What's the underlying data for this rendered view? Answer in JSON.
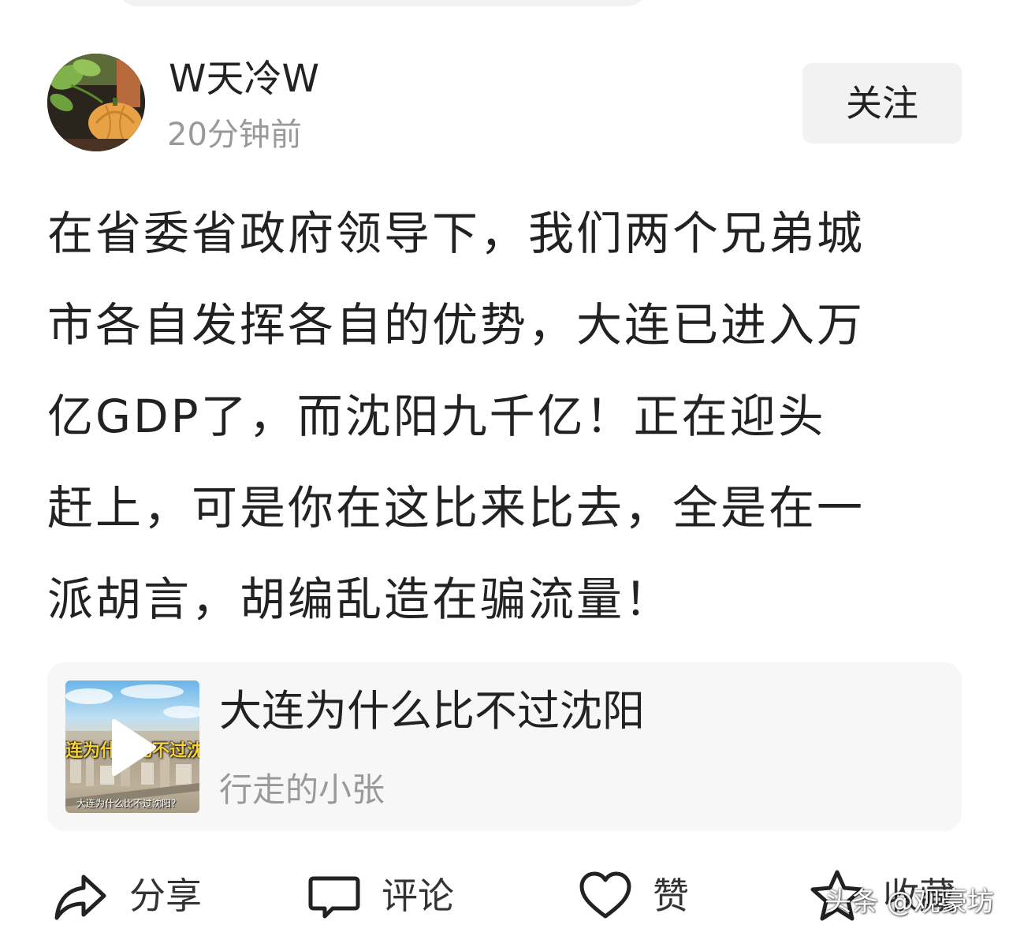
{
  "author": {
    "name": "W天冷W",
    "time": "20分钟前",
    "follow_label": "关注"
  },
  "post": {
    "lines": [
      "在省委省政府领导下，我们两个兄弟城",
      "市各自发挥各自的优势，大连已进入万",
      "亿GDP了，而沈阳九千亿！正在迎头",
      "赶上，可是你在这比来比去，全是在一",
      "派胡言，胡编乱造在骗流量！"
    ]
  },
  "linked_card": {
    "title": "大连为什么比不过沈阳",
    "source": "行走的小张",
    "thumbnail_caption": "连为什么比不过沈",
    "thumbnail_subcaption": "大连为什么比不过沈阳？",
    "play_icon": "play-icon"
  },
  "actions": {
    "share_label": "分享",
    "comment_label": "评论",
    "like_label": "赞",
    "favorite_label": "收藏",
    "share_icon": "share-icon",
    "comment_icon": "comment-icon",
    "like_icon": "heart-icon",
    "favorite_icon": "star-icon"
  },
  "watermark": {
    "text": "头条 @观豪坊"
  },
  "colors": {
    "text_primary": "#222222",
    "text_secondary": "#999999",
    "card_background": "#f7f7f7",
    "button_background": "#f2f2f2"
  }
}
